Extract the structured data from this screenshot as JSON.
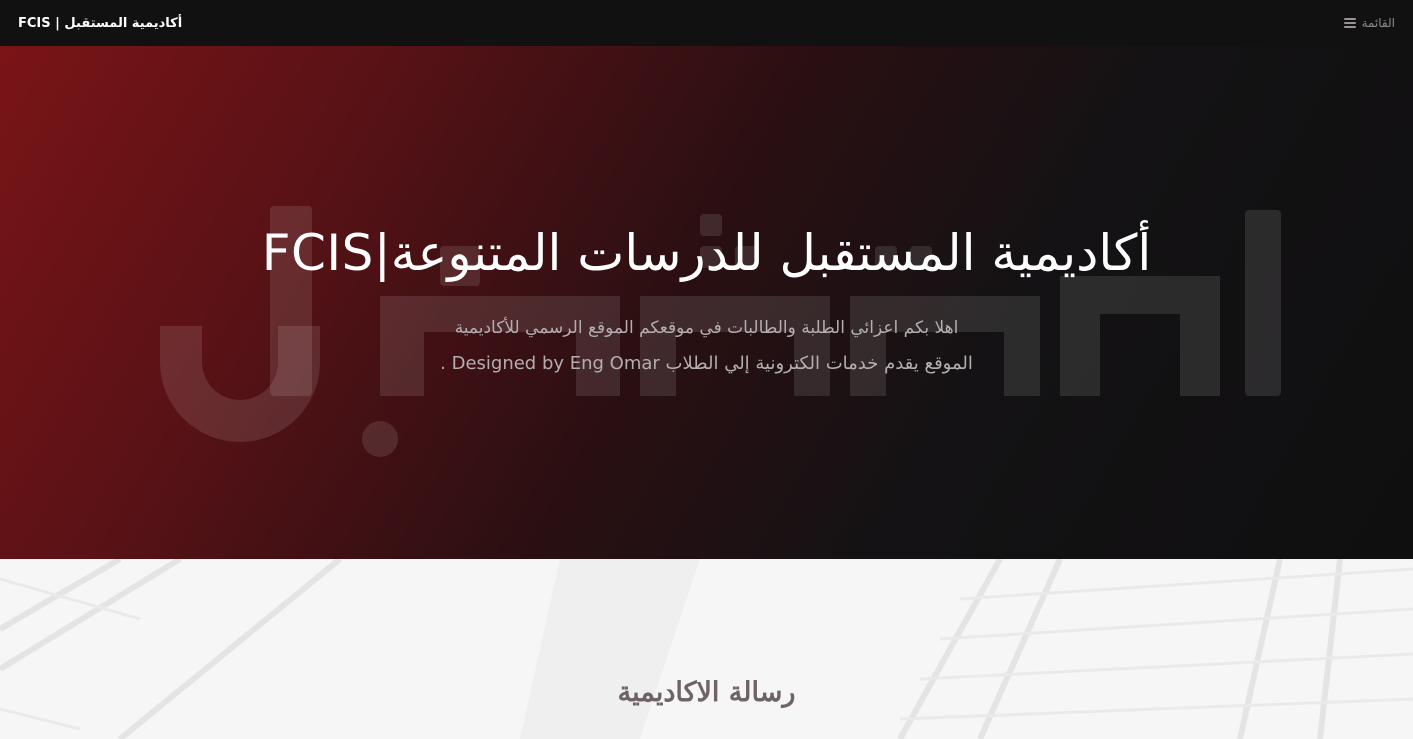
{
  "navbar": {
    "brand": "أكاديمية المستقبل | FCIS",
    "menu_label": "القائمة",
    "menu_icon": "hamburger-icon"
  },
  "hero": {
    "title": "أكاديمية المستقبل للدرسات المتنوعة|FCIS",
    "line1": "اهلا بكم اعزائي الطلبة والطالبات في موقعكم الموقع الرسمي للأكاديمية",
    "line2": "الموقع يقدم خدمات الكترونية إلي الطلاب Designed by Eng Omar ."
  },
  "section": {
    "title": "رسالة الاكاديمية"
  },
  "colors": {
    "navbar_bg": "#121111",
    "hero_accent": "#7a1417",
    "hero_dark": "#0f0f10",
    "text_light": "#ffffff",
    "text_muted": "#b3aeb0",
    "section_title": "#6e6467"
  }
}
